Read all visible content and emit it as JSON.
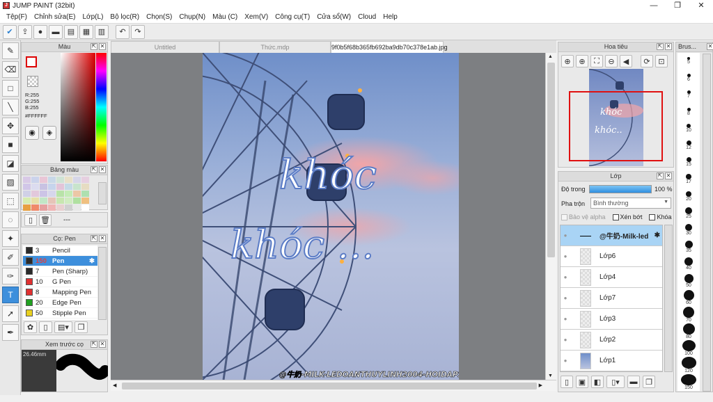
{
  "window": {
    "title": "JUMP PAINT (32bit)",
    "minimize": "—",
    "maximize": "❐",
    "close": "✕"
  },
  "menu": [
    "Tệp(F)",
    "Chỉnh sửa(E)",
    "Lớp(L)",
    "Bộ lọc(R)",
    "Chọn(S)",
    "Chụp(N)",
    "Màu (C)",
    "Xem(V)",
    "Công cụ(T)",
    "Cửa sổ(W)",
    "Cloud",
    "Help"
  ],
  "panels": {
    "color": {
      "title": "Màu",
      "r": "R:255",
      "g": "G:255",
      "b": "B:255",
      "hex": "#FFFFFF"
    },
    "palette": {
      "title": "Bảng màu",
      "dash": "---"
    },
    "brush": {
      "title": "Cọ: Pen",
      "items": [
        {
          "size": "3",
          "name": "Pencil",
          "color": "#2a2a2a"
        },
        {
          "size": "150",
          "name": "Pen",
          "color": "#2a2a2a",
          "selected": true
        },
        {
          "size": "7",
          "name": "Pen (Sharp)",
          "color": "#2a2a2a"
        },
        {
          "size": "10",
          "name": "G Pen",
          "color": "#e03030"
        },
        {
          "size": "8",
          "name": "Mapping Pen",
          "color": "#e03030"
        },
        {
          "size": "20",
          "name": "Edge Pen",
          "color": "#20a020"
        },
        {
          "size": "50",
          "name": "Stipple Pen",
          "color": "#e8d020"
        }
      ]
    },
    "preview": {
      "title": "Xem trước cọ",
      "size": "26.46mm"
    },
    "navigator": {
      "title": "Hoa tiêu"
    },
    "layers": {
      "title": "Lớp",
      "opacity_label": "Độ trong",
      "opacity_value": "100 %",
      "opacity_fraction": 1.0,
      "blend_label": "Pha trộn",
      "blend_value": "Bình thường",
      "protect_alpha": "Bảo vệ alpha",
      "clipping": "Xén bớt",
      "lock": "Khóa",
      "items": [
        {
          "name": "@牛奶-Milk-led",
          "selected": true
        },
        {
          "name": "Lớp6"
        },
        {
          "name": "Lớp4"
        },
        {
          "name": "Lớp7"
        },
        {
          "name": "Lớp3"
        },
        {
          "name": "Lớp2"
        },
        {
          "name": "Lớp1"
        }
      ]
    },
    "brushsizes": {
      "title": "Brus...",
      "sizes": [
        "5",
        "6",
        "7",
        "8",
        "10",
        "12",
        "15",
        "17",
        "20",
        "25",
        "30",
        "35",
        "40",
        "50",
        "60",
        "70",
        "80",
        "100",
        "120",
        "150"
      ]
    }
  },
  "tabs": [
    {
      "label": "Untitled"
    },
    {
      "label": "Thức.mdp"
    },
    {
      "label": "9f0b5f68b365fb692ba9db70c378e1ab.jpg",
      "active": true
    }
  ],
  "canvas": {
    "text_line1": "khóc",
    "text_line2": "khóc ...",
    "watermark": "@牛奶-MILK-LEDOANTHUYLINH2004-HOIDAP247"
  }
}
